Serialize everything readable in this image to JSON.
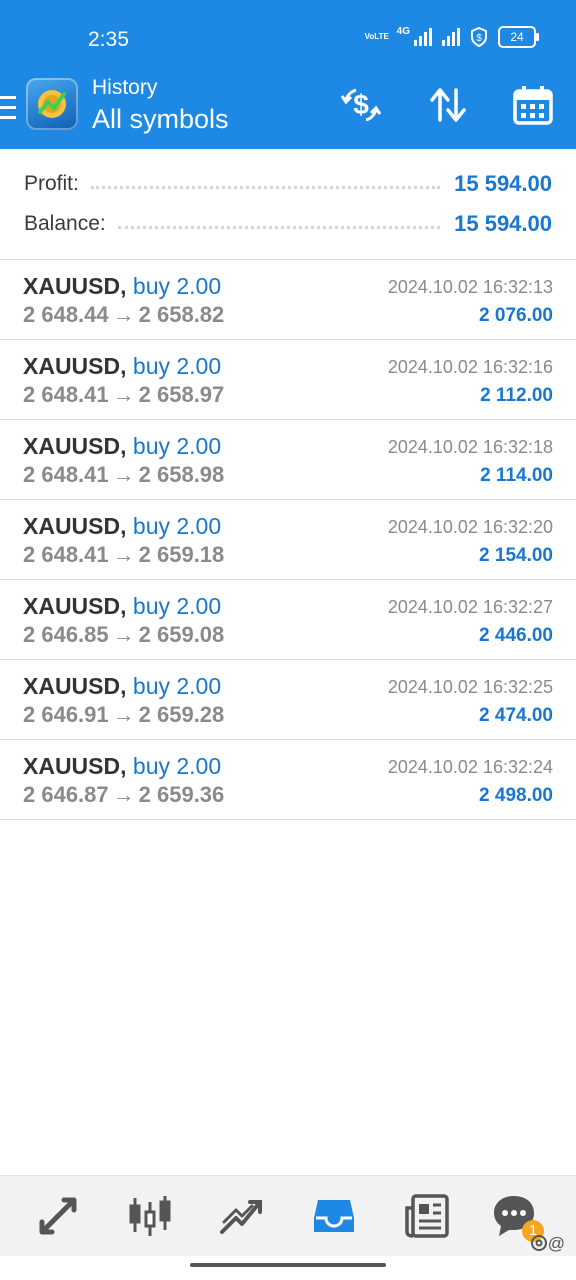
{
  "status_bar": {
    "time": "2:35",
    "volte": "VoLTE",
    "net": "4G",
    "battery": "24"
  },
  "toolbar": {
    "subtitle": "History",
    "title": "All symbols",
    "colors": {
      "background": "#1e88e5",
      "foreground": "#ffffff"
    },
    "icons": [
      "menu-icon",
      "app-logo",
      "currency-exchange-icon",
      "sort-icon",
      "calendar-icon"
    ]
  },
  "summary": {
    "profit_label": "Profit:",
    "profit_value": "15 594.00",
    "balance_label": "Balance:",
    "balance_value": "15 594.00",
    "value_color": "#1976d2"
  },
  "trades": [
    {
      "symbol": "XAUUSD,",
      "side": "buy 2.00",
      "open": "2 648.44",
      "arrow": "→",
      "close": "2 658.82",
      "time": "2024.10.02 16:32:13",
      "profit": "2 076.00"
    },
    {
      "symbol": "XAUUSD,",
      "side": "buy 2.00",
      "open": "2 648.41",
      "arrow": "→",
      "close": "2 658.97",
      "time": "2024.10.02 16:32:16",
      "profit": "2 112.00"
    },
    {
      "symbol": "XAUUSD,",
      "side": "buy 2.00",
      "open": "2 648.41",
      "arrow": "→",
      "close": "2 658.98",
      "time": "2024.10.02 16:32:18",
      "profit": "2 114.00"
    },
    {
      "symbol": "XAUUSD,",
      "side": "buy 2.00",
      "open": "2 648.41",
      "arrow": "→",
      "close": "2 659.18",
      "time": "2024.10.02 16:32:20",
      "profit": "2 154.00"
    },
    {
      "symbol": "XAUUSD,",
      "side": "buy 2.00",
      "open": "2 646.85",
      "arrow": "→",
      "close": "2 659.08",
      "time": "2024.10.02 16:32:27",
      "profit": "2 446.00"
    },
    {
      "symbol": "XAUUSD,",
      "side": "buy 2.00",
      "open": "2 646.91",
      "arrow": "→",
      "close": "2 659.28",
      "time": "2024.10.02 16:32:25",
      "profit": "2 474.00"
    },
    {
      "symbol": "XAUUSD,",
      "side": "buy 2.00",
      "open": "2 646.87",
      "arrow": "→",
      "close": "2 659.36",
      "time": "2024.10.02 16:32:24",
      "profit": "2 498.00"
    }
  ],
  "bottom_nav": {
    "items": [
      "quotes-icon",
      "chart-icon",
      "trade-icon",
      "history-icon",
      "news-icon",
      "chat-icon"
    ],
    "active": "history-icon",
    "active_color": "#1e88e5",
    "inactive_color": "#555555",
    "chat_badge": "1"
  },
  "watermark": "@",
  "watermark_logo": "threads-logo"
}
